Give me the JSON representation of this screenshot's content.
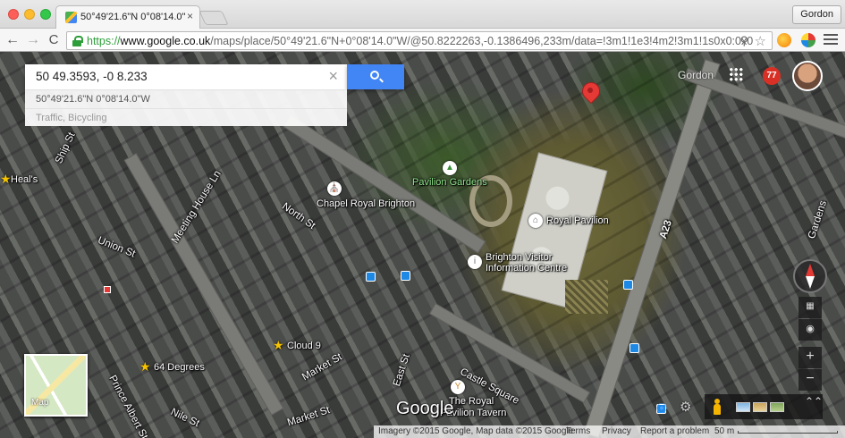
{
  "browser": {
    "tab_title": "50°49'21.6\"N 0°08'14.0\"W",
    "tab_close": "×",
    "profile_name": "Gordon",
    "url_scheme": "https://",
    "url_host": "www.google.co.uk",
    "url_path": "/maps/place/50°49'21.6\"N+0°08'14.0\"W/@50.8222263,-0.1386496,233m/data=!3m1!1e3!4m2!3m1!1s0x0:0x0",
    "back_glyph": "←",
    "forward_glyph": "→",
    "reload_glyph": "C",
    "zoom_glyph": "⚲",
    "star_glyph": "☆"
  },
  "search": {
    "query": "50 49.3593, -0 8.233",
    "clear_glyph": "×",
    "suggestions": [
      "50°49'21.6\"N 0°08'14.0\"W",
      "Traffic, Bicycling"
    ]
  },
  "account": {
    "name": "Gordon",
    "notifications": "77"
  },
  "map_labels": {
    "pavilion_gardens": "Pavilion Gardens",
    "chapel_royal": "Chapel Royal Brighton",
    "royal_pavilion": "Royal Pavilion",
    "visitor_centre_1": "Brighton Visitor",
    "visitor_centre_2": "Information Centre",
    "royal_tavern_1": "The Royal",
    "royal_tavern_2": "Pavilion Tavern",
    "cloud9": "Cloud 9",
    "degrees64": "64 Degrees",
    "heals": "Heal's",
    "north_st": "North St",
    "meeting_house": "Meeting House Ln",
    "union_st": "Union St",
    "ship_st": "Ship St",
    "market_st_1": "Market St",
    "market_st_2": "Market St",
    "east_st": "East St",
    "castle_sq": "Castle Square",
    "nile_st": "Nile St",
    "prince_albert": "Prince Albert St",
    "a23": "A23",
    "gardens": "Gardens"
  },
  "controls": {
    "zoom_in": "+",
    "zoom_out": "−",
    "tilt": "▦",
    "rotate": "◉",
    "minimap_label": "Map",
    "expand": "⌃⌃",
    "gear": "⚙"
  },
  "google_logo": "Google",
  "footer": {
    "imagery": "Imagery ©2015 Google, Map data ©2015 Google",
    "terms": "Terms",
    "privacy": "Privacy",
    "report": "Report a problem",
    "scale": "50 m"
  },
  "icons": {
    "park": "tree-icon",
    "chapel": "church-icon",
    "museum": "museum-icon",
    "info": "info-centre-icon",
    "tavern": "bar-icon",
    "bus": "bus-stop-icon",
    "star": "saved-star-icon",
    "pin": "location-pin-icon"
  },
  "colors": {
    "search_button": "#4285f4",
    "pin": "#e53935",
    "notification_badge": "#d93025",
    "url_scheme": "#2e9e3a"
  }
}
